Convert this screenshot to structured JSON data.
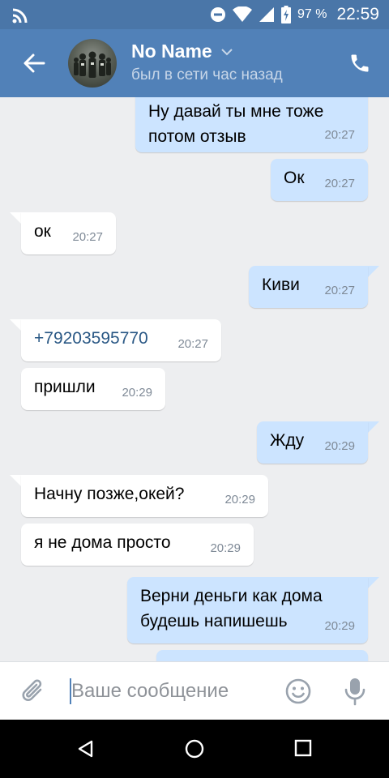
{
  "status_bar": {
    "battery": "97 %",
    "time": "22:59"
  },
  "header": {
    "name": "No Name",
    "status": "был в сети час назад"
  },
  "messages": [
    {
      "dir": "out",
      "text": "Ну давай ты мне тоже потом отзыв",
      "time": "20:27"
    },
    {
      "dir": "out",
      "text": "Ок",
      "time": "20:27"
    },
    {
      "dir": "in",
      "text": "ок",
      "time": "20:27"
    },
    {
      "dir": "out",
      "text": "Киви",
      "time": "20:27"
    },
    {
      "dir": "in",
      "text": "+79203595770",
      "time": "20:27",
      "link": true
    },
    {
      "dir": "in",
      "text": "пришли",
      "time": "20:29"
    },
    {
      "dir": "out",
      "text": "Жду",
      "time": "20:29"
    },
    {
      "dir": "in",
      "text": "Начну позже,окей?",
      "time": "20:29"
    },
    {
      "dir": "in",
      "text": "я не дома просто",
      "time": "20:29"
    },
    {
      "dir": "out",
      "text": "Верни деньги как дома будешь напишешь",
      "time": "20:29"
    }
  ],
  "composer": {
    "placeholder": "Ваше сообщение"
  },
  "colors": {
    "header": "#5181b8",
    "status_bar": "#4a76a8",
    "out_bubble": "#cce4ff",
    "in_bubble": "#ffffff",
    "background": "#edeef0"
  }
}
